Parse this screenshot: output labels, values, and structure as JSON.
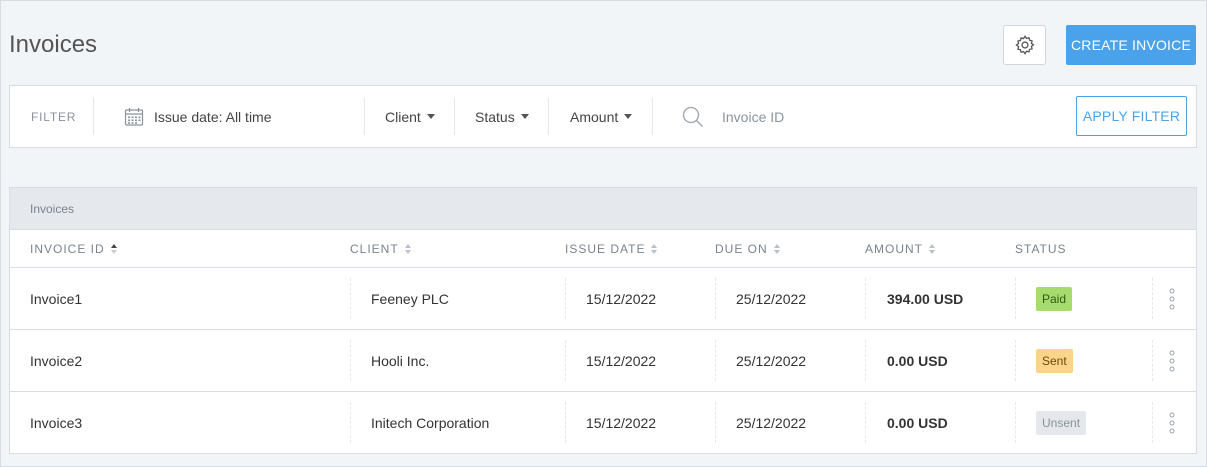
{
  "header": {
    "title": "Invoices",
    "create_label": "CREATE INVOICE"
  },
  "filter": {
    "label": "FILTER",
    "issue_date": "Issue date: All time",
    "client": "Client",
    "status": "Status",
    "amount": "Amount",
    "invoice_id_placeholder": "Invoice ID",
    "apply_label": "APPLY FILTER"
  },
  "table": {
    "caption": "Invoices",
    "columns": {
      "invoice_id": "INVOICE ID",
      "client": "CLIENT",
      "issue_date": "ISSUE DATE",
      "due_on": "DUE ON",
      "amount": "AMOUNT",
      "status": "STATUS"
    },
    "rows": [
      {
        "id": "Invoice1",
        "client": "Feeney PLC",
        "issue_date": "15/12/2022",
        "due_on": "25/12/2022",
        "amount": "394.00 USD",
        "status": "Paid",
        "status_bg": "#a6dc6e",
        "status_fg": "#2f5a12"
      },
      {
        "id": "Invoice2",
        "client": "Hooli Inc.",
        "issue_date": "15/12/2022",
        "due_on": "25/12/2022",
        "amount": "0.00 USD",
        "status": "Sent",
        "status_bg": "#fad48b",
        "status_fg": "#6a4a0a"
      },
      {
        "id": "Invoice3",
        "client": "Initech Corporation",
        "issue_date": "15/12/2022",
        "due_on": "25/12/2022",
        "amount": "0.00 USD",
        "status": "Unsent",
        "status_bg": "#e4e8ec",
        "status_fg": "#8a939c"
      }
    ]
  },
  "colors": {
    "accent": "#4aa3ea"
  },
  "icons": {
    "settings": "gear-icon",
    "calendar": "calendar-icon",
    "search": "search-icon",
    "row_menu": "more-vertical-icon"
  }
}
